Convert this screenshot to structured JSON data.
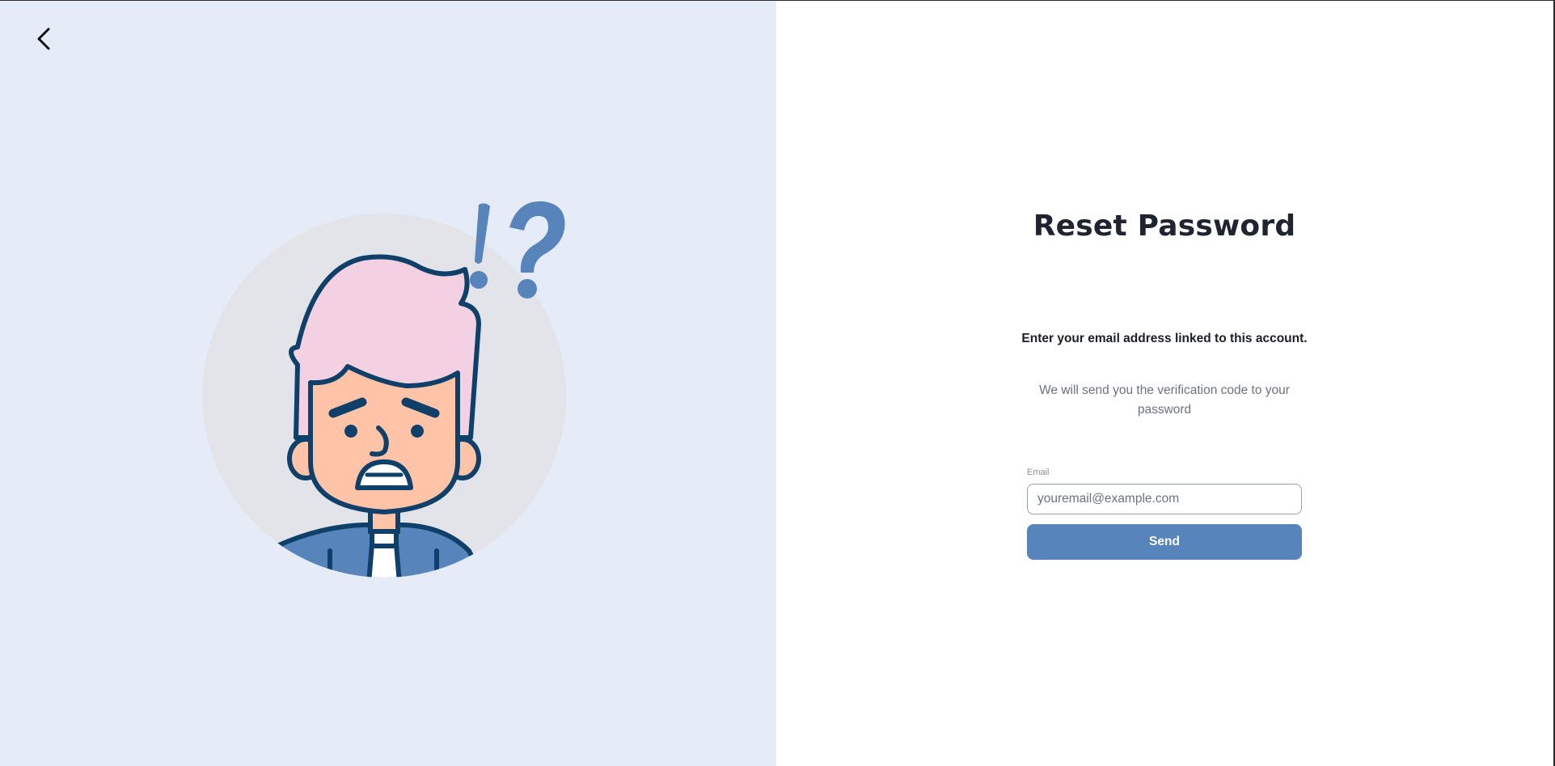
{
  "nav": {
    "back_icon": "chevron-left-icon"
  },
  "illustration": {
    "subject": "confused-person-illustration",
    "marks": "!?"
  },
  "form": {
    "title": "Reset Password",
    "subtitle": "Enter your email address linked to this account.",
    "description": "We will send you the verification code to your password",
    "email_label": "Email",
    "email_placeholder": "youremail@example.com",
    "email_value": "",
    "send_label": "Send"
  },
  "colors": {
    "left_panel_bg": "#e6ecf7",
    "accent": "#5784ba",
    "text_dark": "#1f2430",
    "text_muted": "#6b7280"
  }
}
